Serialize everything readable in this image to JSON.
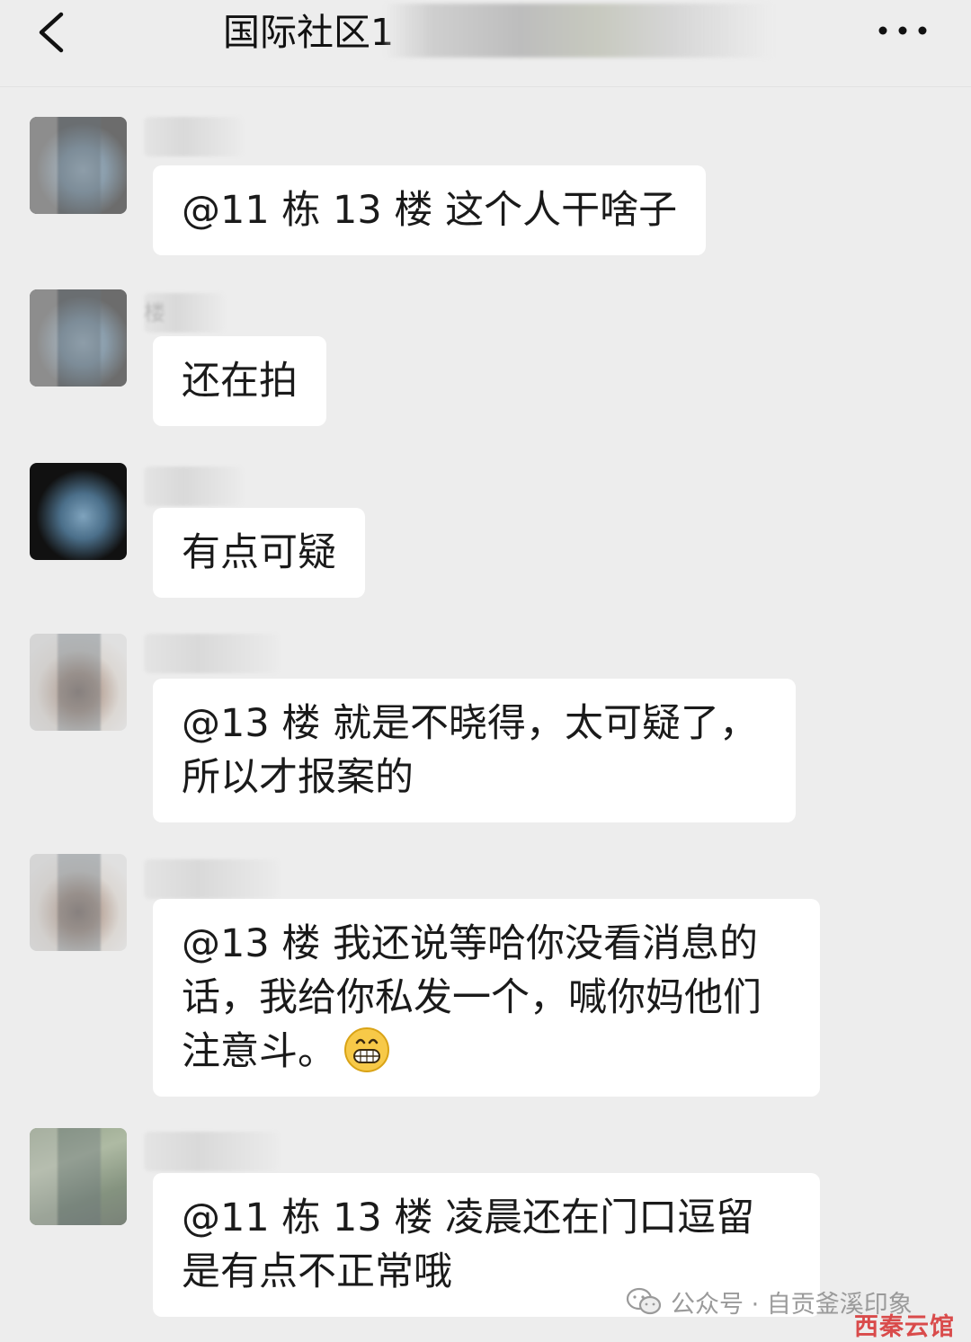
{
  "header": {
    "title": "国际社区1",
    "back_icon": "chevron-left-icon",
    "more_icon": "more-dots-icon"
  },
  "messages": [
    {
      "avatar": "avatar-dark",
      "sender": "",
      "text": "@11 栋 13 楼  这个人干啥子"
    },
    {
      "avatar": "avatar-dark",
      "sender": "楼",
      "text": "还在拍"
    },
    {
      "avatar": "avatar-dark",
      "sender": "",
      "text": "有点可疑"
    },
    {
      "avatar": "avatar-girl",
      "sender": "",
      "text": "@13 楼  就是不晓得，太可疑了，所以才报案的"
    },
    {
      "avatar": "avatar-girl",
      "sender": "",
      "text": "@13 楼  我还说等哈你没看消息的话，我给你私发一个，喊你妈他们注意斗。",
      "emoji": "grin-emoji"
    },
    {
      "avatar": "avatar-forest",
      "sender": "",
      "text": "@11 栋 13 楼  凌晨还在门口逗留是有点不正常哦"
    }
  ],
  "watermark": {
    "text": "公众号 · 自贡釜溪印象",
    "logo": "西秦云馆",
    "icon": "wechat-icon"
  },
  "colors": {
    "background": "#ededed",
    "bubble": "#ffffff",
    "logo": "#d94b4b"
  }
}
